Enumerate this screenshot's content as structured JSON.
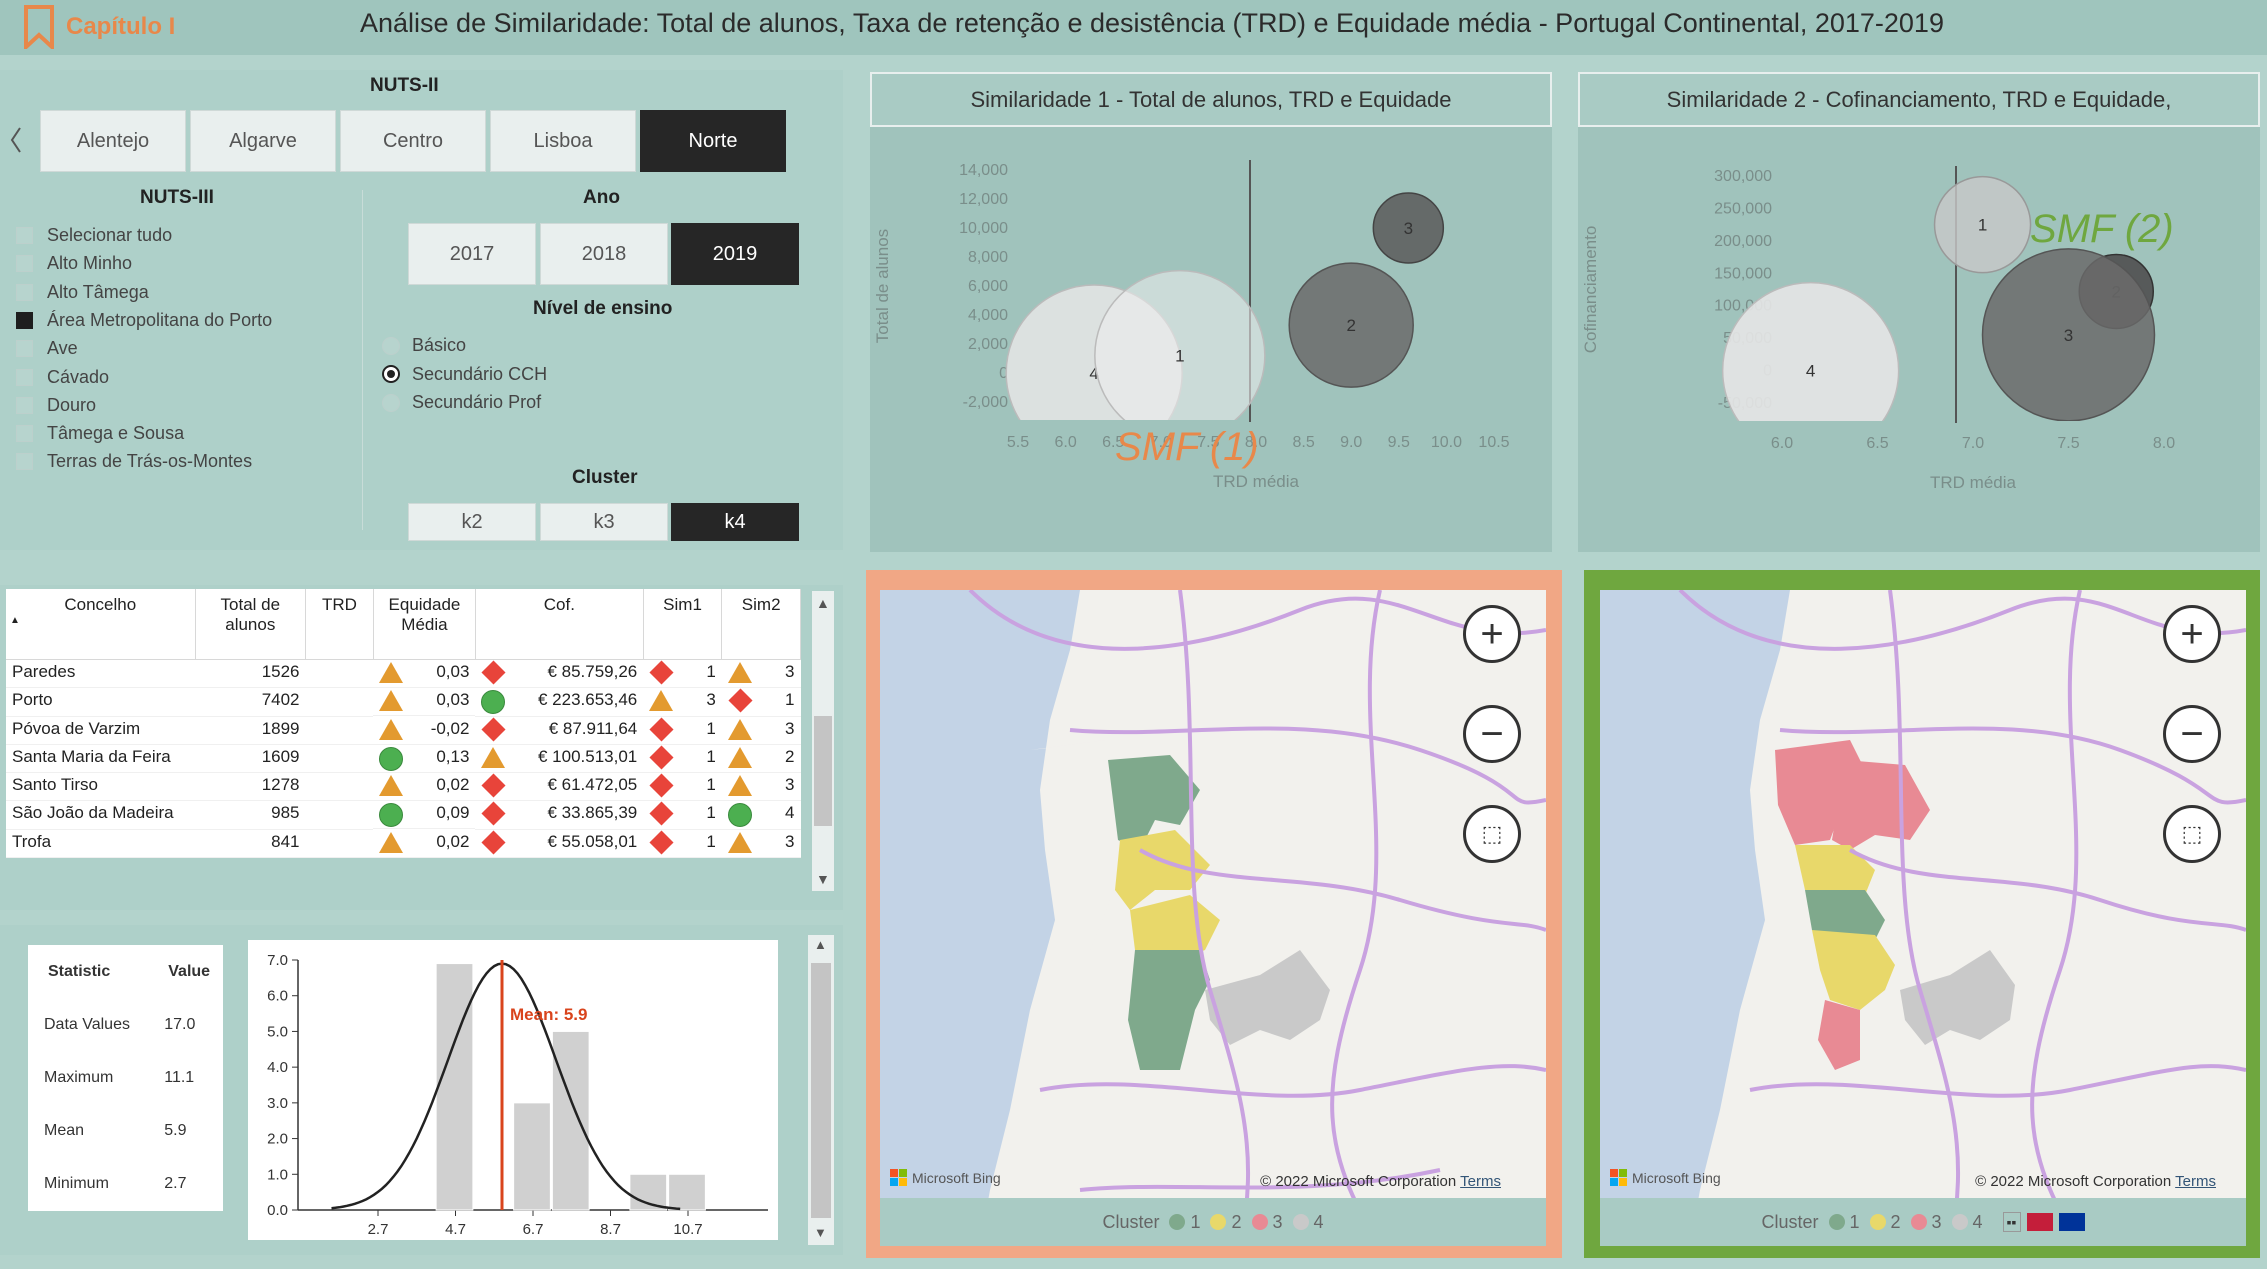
{
  "header": {
    "chapter": "Capítulo I",
    "title": "Análise de Similaridade: Total de alunos, Taxa de retenção e desistência (TRD) e Equidade média - Portugal Continental, 2017-2019"
  },
  "nuts2": {
    "label": "NUTS-II",
    "tabs": [
      "Alentejo",
      "Algarve",
      "Centro",
      "Lisboa",
      "Norte"
    ],
    "selected": "Norte"
  },
  "nuts3": {
    "label": "NUTS-III",
    "items": [
      {
        "label": "Selecionar tudo",
        "checked": false
      },
      {
        "label": "Alto Minho",
        "checked": false
      },
      {
        "label": "Alto Tâmega",
        "checked": false
      },
      {
        "label": "Área Metropolitana do Porto",
        "checked": true
      },
      {
        "label": "Ave",
        "checked": false
      },
      {
        "label": "Cávado",
        "checked": false
      },
      {
        "label": "Douro",
        "checked": false
      },
      {
        "label": "Tâmega e Sousa",
        "checked": false
      },
      {
        "label": "Terras de Trás-os-Montes",
        "checked": false
      }
    ]
  },
  "ano": {
    "label": "Ano",
    "options": [
      "2017",
      "2018",
      "2019"
    ],
    "selected": "2019"
  },
  "nivel": {
    "label": "Nível de ensino",
    "options": [
      "Básico",
      "Secundário CCH",
      "Secundário Prof"
    ],
    "selected": "Secundário CCH"
  },
  "cluster": {
    "label": "Cluster",
    "options": [
      "k2",
      "k3",
      "k4"
    ],
    "selected": "k4"
  },
  "sim1": {
    "title": "Similaridade 1 - Total de alunos, TRD e Equidade",
    "xlabel": "TRD média",
    "ylabel": "Total de alunos",
    "xticks": [
      "5.5",
      "6.0",
      "6.5",
      "7.0",
      "7.5",
      "8.0",
      "8.5",
      "9.0",
      "9.5",
      "10.0",
      "10.5"
    ],
    "yticks": [
      "14,000",
      "12,000",
      "10,000",
      "8,000",
      "6,000",
      "4,000",
      "2,000",
      "0",
      "-2,000"
    ],
    "annotation": "SMF (1)",
    "bubbles": [
      {
        "label": "4",
        "x": 6.3,
        "y": 0
      },
      {
        "label": "1",
        "x": 7.2,
        "y": 1200
      },
      {
        "label": "2",
        "x": 9.0,
        "y": 3300
      },
      {
        "label": "3",
        "x": 9.6,
        "y": 10000
      }
    ]
  },
  "sim2": {
    "title": "Similaridade 2 - Cofinanciamento, TRD e Equidade,",
    "xlabel": "TRD média",
    "ylabel": "Cofinanciamento",
    "xticks": [
      "6.0",
      "6.5",
      "7.0",
      "7.5",
      "8.0"
    ],
    "yticks": [
      "300,000",
      "250,000",
      "200,000",
      "150,000",
      "100,000",
      "50,000",
      "0",
      "-50,000"
    ],
    "annotation": "SMF (2)",
    "bubbles": [
      {
        "label": "1",
        "x": 7.05,
        "y": 225000
      },
      {
        "label": "2",
        "x": 7.75,
        "y": 122000
      },
      {
        "label": "3",
        "x": 7.5,
        "y": 55000
      },
      {
        "label": "4",
        "x": 6.15,
        "y": 0
      }
    ]
  },
  "table": {
    "headers": [
      "Concelho",
      "Total de alunos",
      "TRD",
      "Equidade Média",
      "Cof.",
      "Sim1",
      "Sim2"
    ],
    "rows": [
      {
        "concelho": "Paredes",
        "total": "1526",
        "eq_icon": "tri",
        "eq": "0,03",
        "cof_icon": "dia",
        "cof": "€ 85.759,26",
        "s1_icon": "dia",
        "s1": "1",
        "s2_icon": "tri",
        "s2": "3"
      },
      {
        "concelho": "Porto",
        "total": "7402",
        "eq_icon": "tri",
        "eq": "0,03",
        "cof_icon": "cir",
        "cof": "€ 223.653,46",
        "s1_icon": "tri",
        "s1": "3",
        "s2_icon": "dia",
        "s2": "1"
      },
      {
        "concelho": "Póvoa de Varzim",
        "total": "1899",
        "eq_icon": "tri",
        "eq": "-0,02",
        "cof_icon": "dia",
        "cof": "€ 87.911,64",
        "s1_icon": "dia",
        "s1": "1",
        "s2_icon": "tri",
        "s2": "3"
      },
      {
        "concelho": "Santa Maria da Feira",
        "total": "1609",
        "eq_icon": "cir",
        "eq": "0,13",
        "cof_icon": "tri",
        "cof": "€ 100.513,01",
        "s1_icon": "dia",
        "s1": "1",
        "s2_icon": "tri",
        "s2": "2"
      },
      {
        "concelho": "Santo Tirso",
        "total": "1278",
        "eq_icon": "tri",
        "eq": "0,02",
        "cof_icon": "dia",
        "cof": "€ 61.472,05",
        "s1_icon": "dia",
        "s1": "1",
        "s2_icon": "tri",
        "s2": "3"
      },
      {
        "concelho": "São João da Madeira",
        "total": "985",
        "eq_icon": "cir",
        "eq": "0,09",
        "cof_icon": "dia",
        "cof": "€ 33.865,39",
        "s1_icon": "dia",
        "s1": "1",
        "s2_icon": "cir",
        "s2": "4"
      },
      {
        "concelho": "Trofa",
        "total": "841",
        "eq_icon": "tri",
        "eq": "0,02",
        "cof_icon": "dia",
        "cof": "€ 55.058,01",
        "s1_icon": "dia",
        "s1": "1",
        "s2_icon": "tri",
        "s2": "3"
      }
    ]
  },
  "stats": {
    "headers": [
      "Statistic",
      "Value"
    ],
    "rows": [
      [
        "Data Values",
        "17.0"
      ],
      [
        "Maximum",
        "11.1"
      ],
      [
        "Mean",
        "5.9"
      ],
      [
        "Minimum",
        "2.7"
      ]
    ]
  },
  "chart_data": {
    "type": "bar",
    "categories": [
      "2.7",
      "3.7",
      "4.7",
      "5.7",
      "6.7",
      "7.7",
      "8.7",
      "9.7",
      "10.7"
    ],
    "values": [
      0,
      0,
      6.9,
      0,
      3.0,
      5.0,
      0,
      1.0,
      1.0
    ],
    "ylim": [
      0,
      7
    ],
    "yticks": [
      "7.0",
      "6.0",
      "5.0",
      "4.0",
      "3.0",
      "2.0",
      "1.0",
      "0.0"
    ],
    "xticks": [
      "2.7",
      "4.7",
      "6.7",
      "8.7",
      "10.7"
    ],
    "mean_label": "Mean: 5.9",
    "mean": 5.9
  },
  "maps": {
    "legend_title": "Cluster",
    "legend": [
      {
        "label": "1",
        "color": "#7fa98c"
      },
      {
        "label": "2",
        "color": "#e8d86a"
      },
      {
        "label": "3",
        "color": "#e88a94"
      },
      {
        "label": "4",
        "color": "#c9c9c9"
      }
    ],
    "attribution": "© 2022 Microsoft Corporation",
    "terms": "Terms",
    "bing": "Microsoft Bing",
    "colors": {
      "map1_frame": "#f1a785",
      "map2_frame": "#6fa73f"
    }
  }
}
